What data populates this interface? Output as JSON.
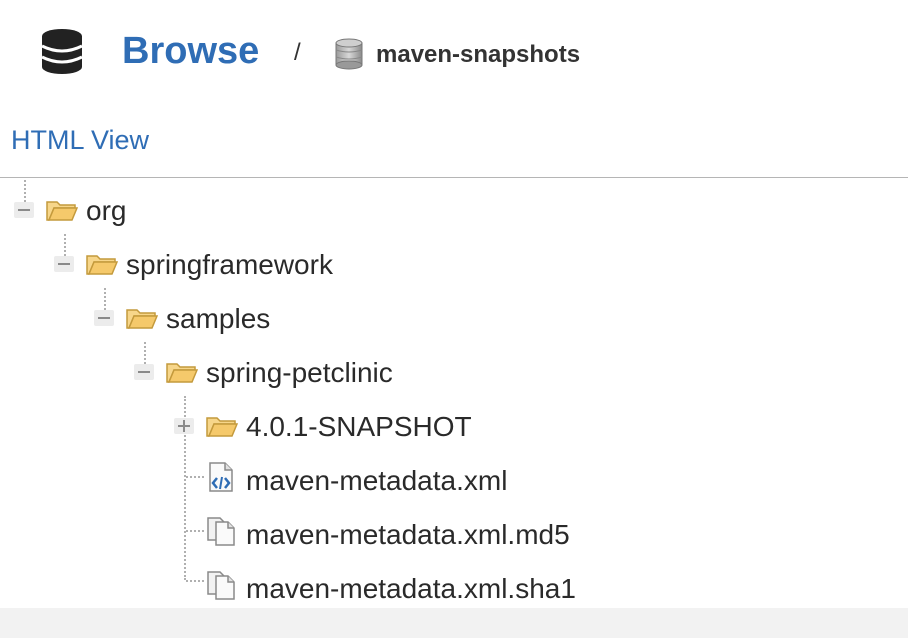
{
  "header": {
    "title": "Browse",
    "separator": "/",
    "repository": "maven-snapshots",
    "icons": {
      "section": "database-icon",
      "repository": "repository-cylinder-icon"
    }
  },
  "view_link": "HTML View",
  "tree": {
    "nodes": [
      {
        "label": "org",
        "type": "folder",
        "expanded": true
      },
      {
        "label": "springframework",
        "type": "folder",
        "expanded": true
      },
      {
        "label": "samples",
        "type": "folder",
        "expanded": true
      },
      {
        "label": "spring-petclinic",
        "type": "folder",
        "expanded": true
      },
      {
        "label": "4.0.1-SNAPSHOT",
        "type": "folder",
        "expanded": false
      },
      {
        "label": "maven-metadata.xml",
        "type": "xml-file"
      },
      {
        "label": "maven-metadata.xml.md5",
        "type": "file"
      },
      {
        "label": "maven-metadata.xml.sha1",
        "type": "file"
      }
    ]
  },
  "colors": {
    "link": "#2f6db5",
    "folder": "#f5c96b",
    "folder_outline": "#c49a3c",
    "divider": "#b5b5b5"
  }
}
